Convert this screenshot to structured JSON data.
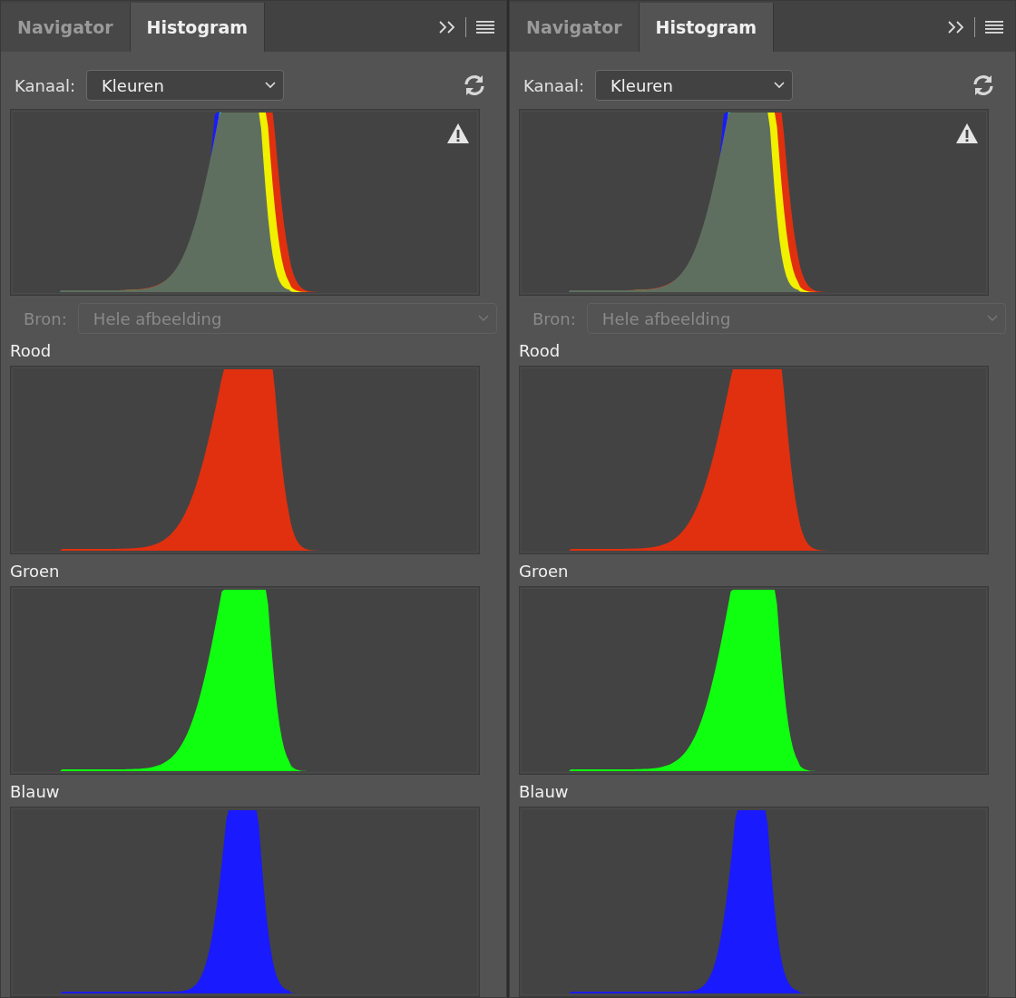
{
  "panels": [
    {
      "tabs": [
        {
          "label": "Navigator",
          "selected": false
        },
        {
          "label": "Histogram",
          "selected": true
        }
      ],
      "channel": {
        "label": "Kanaal:",
        "value": "Kleuren"
      },
      "source": {
        "label": "Bron:",
        "value": "Hele afbeelding",
        "disabled": true
      },
      "warning": true,
      "channels": [
        {
          "name": "Rood",
          "kind": "red"
        },
        {
          "name": "Groen",
          "kind": "green"
        },
        {
          "name": "Blauw",
          "kind": "blue"
        }
      ]
    },
    {
      "tabs": [
        {
          "label": "Navigator",
          "selected": false
        },
        {
          "label": "Histogram",
          "selected": true
        }
      ],
      "channel": {
        "label": "Kanaal:",
        "value": "Kleuren"
      },
      "source": {
        "label": "Bron:",
        "value": "Hele afbeelding",
        "disabled": true
      },
      "warning": true,
      "channels": [
        {
          "name": "Rood",
          "kind": "red"
        },
        {
          "name": "Groen",
          "kind": "green"
        },
        {
          "name": "Blauw",
          "kind": "blue"
        }
      ]
    }
  ]
}
